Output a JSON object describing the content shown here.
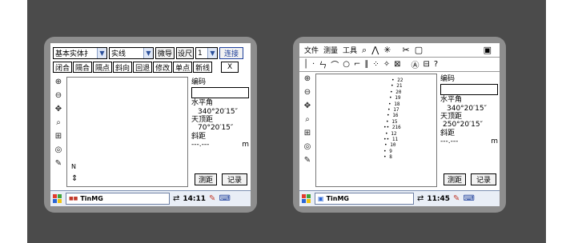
{
  "left": {
    "toolbar": {
      "mode_combo": "基本实体扌",
      "line_combo": "实线",
      "guide_btn": "微导",
      "set_btn": "设尺",
      "num_combo": "1",
      "connect_btn": "连接"
    },
    "toolbar2": [
      "闭合",
      "隔合",
      "隔点",
      "斜向",
      "回退",
      "修改",
      "单点",
      "新线"
    ],
    "close_btn": "X",
    "info": {
      "code_label": "编码",
      "hangle_label": "水平角",
      "hangle_value": "340°20′15″",
      "zenith_label": "天顶距",
      "zenith_value": "70°20′15″",
      "slope_label": "斜距",
      "slope_value": "---.---",
      "slope_unit": "m"
    },
    "north_label": "N",
    "measure_btn": "测距",
    "record_btn": "记录",
    "taskbar": {
      "app": "TinMG",
      "time": "14:11"
    }
  },
  "right": {
    "menus": [
      "文件",
      "测量",
      "工具"
    ],
    "info": {
      "code_label": "编码",
      "hangle_label": "水平角",
      "hangle_value": "340°20′15″",
      "zenith_label": "天顶距",
      "zenith_value": "250°20′15″",
      "slope_label": "斜距",
      "slope_value": "---.---",
      "slope_unit": "m"
    },
    "points": [
      "22",
      "21",
      "20",
      "19",
      "18",
      "17",
      "16",
      "15",
      "216",
      "12",
      "11",
      "10",
      "9",
      "8"
    ],
    "measure_btn": "测距",
    "record_btn": "记录",
    "taskbar": {
      "app": "TinMG",
      "time": "11:45"
    }
  },
  "colors": {
    "backdrop": "#4b4b4b",
    "bezel": "#8d8d8d",
    "accent": "#1e3f9a"
  }
}
